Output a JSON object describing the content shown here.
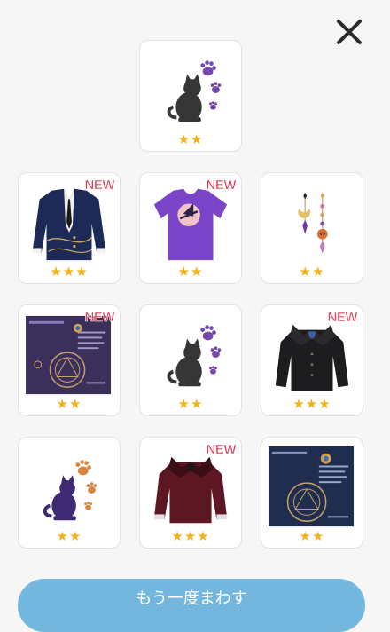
{
  "close_icon": "close-icon",
  "colors": {
    "star": "#f2b21c",
    "new": "#e53a4f",
    "button": "#74b7de"
  },
  "rewards": [
    {
      "item": "cat-paws-icon",
      "stars": "★★",
      "badge": ""
    },
    {
      "item": "navy-jacket-icon",
      "stars": "★★★",
      "badge": "NEW"
    },
    {
      "item": "purple-witch-tshirt-icon",
      "stars": "★★",
      "badge": "NEW"
    },
    {
      "item": "moon-earrings-icon",
      "stars": "★★",
      "badge": ""
    },
    {
      "item": "magic-circle-poster-icon",
      "stars": "★★",
      "badge": "NEW"
    },
    {
      "item": "cat-paws-icon",
      "stars": "★★",
      "badge": ""
    },
    {
      "item": "black-ruffle-blouse-icon",
      "stars": "★★★",
      "badge": "NEW"
    },
    {
      "item": "purple-cat-paws-icon",
      "stars": "★★",
      "badge": ""
    },
    {
      "item": "wine-ruffle-blouse-icon",
      "stars": "★★★",
      "badge": "NEW"
    },
    {
      "item": "magic-circle-poster-icon",
      "stars": "★★",
      "badge": ""
    }
  ],
  "spin_again_label": "もう一度まわす"
}
